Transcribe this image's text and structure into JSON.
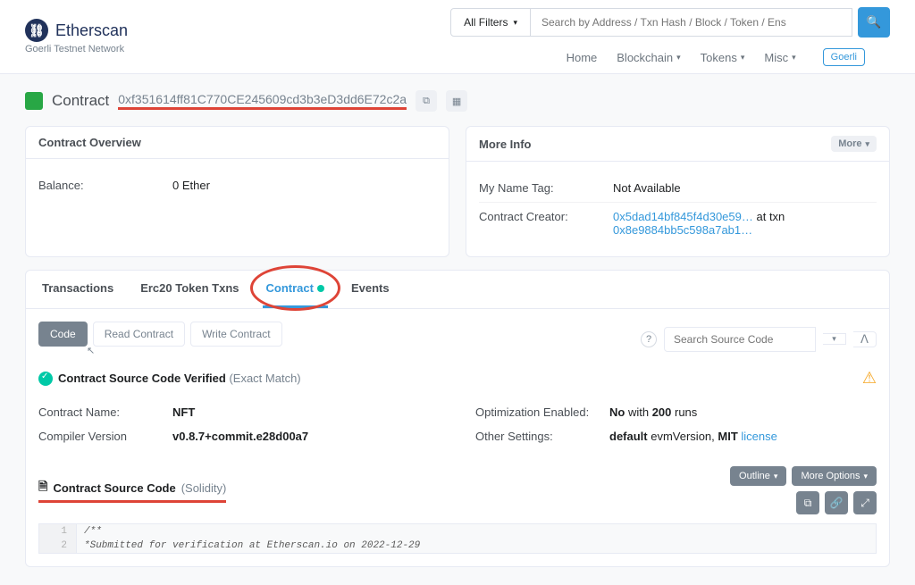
{
  "brand": {
    "name": "Etherscan",
    "subtitle": "Goerli Testnet Network"
  },
  "search": {
    "filter_label": "All Filters",
    "placeholder": "Search by Address / Txn Hash / Block / Token / Ens"
  },
  "nav": {
    "home": "Home",
    "blockchain": "Blockchain",
    "tokens": "Tokens",
    "misc": "Misc",
    "badge": "Goerli"
  },
  "page": {
    "label": "Contract",
    "address": "0xf351614ff81C770CE245609cd3b3eD3dd6E72c2a"
  },
  "overview": {
    "title": "Contract Overview",
    "balance_label": "Balance:",
    "balance_value": "0 Ether"
  },
  "moreinfo": {
    "title": "More Info",
    "more_label": "More",
    "tag_label": "My Name Tag:",
    "tag_value": "Not Available",
    "creator_label": "Contract Creator:",
    "creator_addr": "0x5dad14bf845f4d30e59…",
    "creator_mid": " at txn ",
    "creator_txn": "0x8e9884bb5c598a7ab1…"
  },
  "tabs": {
    "t1": "Transactions",
    "t2": "Erc20 Token Txns",
    "t3": "Contract",
    "t4": "Events"
  },
  "subtabs": {
    "code": "Code",
    "read": "Read Contract",
    "write": "Write Contract"
  },
  "source_search": {
    "placeholder": "Search Source Code"
  },
  "verified": {
    "bold": "Contract Source Code Verified",
    "paren": "(Exact Match)"
  },
  "info": {
    "name_l": "Contract Name:",
    "name_v": "NFT",
    "compiler_l": "Compiler Version",
    "compiler_v": "v0.8.7+commit.e28d00a7",
    "opt_l": "Optimization Enabled:",
    "opt_v_pre": "No",
    "opt_v_mid": " with ",
    "opt_v_runs": "200",
    "opt_v_post": " runs",
    "other_l": "Other Settings:",
    "other_v_pre": "default",
    "other_v_mid": " evmVersion, ",
    "other_v_lic": "MIT",
    "other_v_link": "license"
  },
  "source_section": {
    "title": "Contract Source Code",
    "lang": "(Solidity)",
    "outline": "Outline",
    "more_opts": "More Options"
  },
  "code": {
    "l1n": "1",
    "l1t": "/**",
    "l2n": "2",
    "l2t": " *Submitted for verification at Etherscan.io on 2022-12-29"
  }
}
